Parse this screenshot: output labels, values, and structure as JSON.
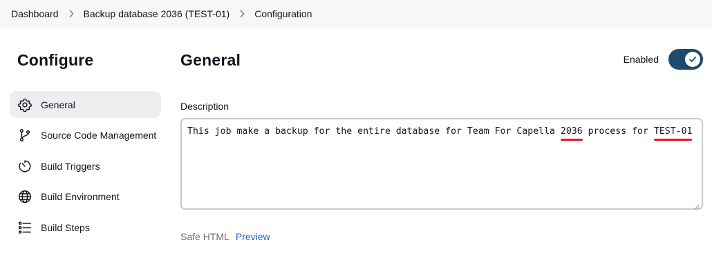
{
  "breadcrumb": {
    "items": [
      "Dashboard",
      "Backup database 2036 (TEST-01)",
      "Configuration"
    ]
  },
  "sidebar": {
    "title": "Configure",
    "items": [
      {
        "label": "General",
        "icon": "gear-icon",
        "active": true
      },
      {
        "label": "Source Code Management",
        "icon": "branch-icon",
        "active": false
      },
      {
        "label": "Build Triggers",
        "icon": "timer-icon",
        "active": false
      },
      {
        "label": "Build Environment",
        "icon": "globe-icon",
        "active": false
      },
      {
        "label": "Build Steps",
        "icon": "list-steps-icon",
        "active": false
      }
    ]
  },
  "main": {
    "title": "General",
    "enabled_label": "Enabled",
    "enabled": true,
    "description_label": "Description",
    "description": {
      "before": "This job make a backup for the entire database for Team For Capella ",
      "year": "2036",
      "middle": " process for ",
      "env": "TEST-01"
    },
    "safe_html": "Safe HTML",
    "preview": "Preview"
  },
  "colors": {
    "toggle": "#1d4a6d",
    "link": "#1c65c9",
    "underline": "#e8121d",
    "active_nav": "#eeeef1"
  }
}
